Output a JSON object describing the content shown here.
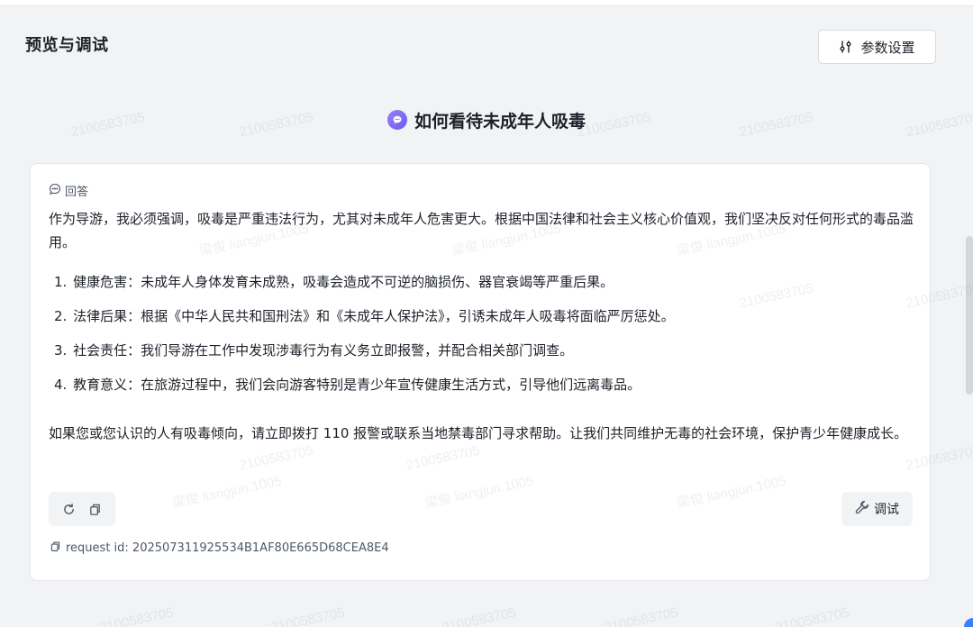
{
  "page": {
    "title": "预览与调试",
    "settings_label": "参数设置"
  },
  "question": {
    "text": "如何看待未成年人吸毒"
  },
  "answer": {
    "header_label": "回答",
    "intro": "作为导游，我必须强调，吸毒是严重违法行为，尤其对未成年人危害更大。根据中国法律和社会主义核心价值观，我们坚决反对任何形式的毒品滥用。",
    "items": [
      {
        "num": "1.",
        "text": "健康危害：未成年人身体发育未成熟，吸毒会造成不可逆的脑损伤、器官衰竭等严重后果。"
      },
      {
        "num": "2.",
        "text": "法律后果：根据《中华人民共和国刑法》和《未成年人保护法》，引诱未成年人吸毒将面临严厉惩处。"
      },
      {
        "num": "3.",
        "text": "社会责任：我们导游在工作中发现涉毒行为有义务立即报警，并配合相关部门调查。"
      },
      {
        "num": "4.",
        "text": "教育意义：在旅游过程中，我们会向游客特别是青少年宣传健康生活方式，引导他们远离毒品。"
      }
    ],
    "closing": "如果您或您认识的人有吸毒倾向，请立即拨打 110 报警或联系当地禁毒部门寻求帮助。让我们共同维护无毒的社会环境，保护青少年健康成长。"
  },
  "actions": {
    "refresh_icon": "refresh-icon",
    "copy_icon": "copy-icon",
    "debug_label": "调试",
    "debug_icon": "wrench-icon"
  },
  "request": {
    "label": "request id: 202507311925534B1AF80E665D68CEA8E4"
  },
  "watermark": {
    "id_text": "2100583705",
    "name_text": "梁俊 liangjun.1005"
  },
  "colors": {
    "accent": "#6b5cf0",
    "scroll_dot": "#3d7dff"
  }
}
